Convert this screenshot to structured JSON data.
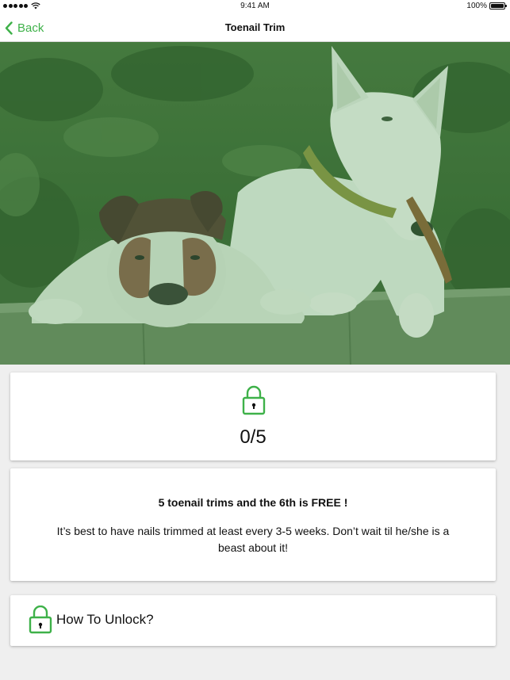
{
  "status_bar": {
    "time": "9:41 AM",
    "battery_text": "100%",
    "battery_level": 1.0,
    "signal_bars": 5,
    "icons": [
      "signal-dots-icon",
      "wifi-icon",
      "battery-icon"
    ]
  },
  "nav": {
    "back_label": "Back",
    "title": "Toenail Trim"
  },
  "colors": {
    "accent": "#3eb149",
    "hero_tint": "#2f7a2f",
    "background": "#efefef",
    "card": "#ffffff"
  },
  "hero": {
    "icon": "dogs-photo"
  },
  "progress": {
    "icon": "lock-icon",
    "count": "0/5",
    "completed": 0,
    "total": 5
  },
  "info": {
    "title": "5 toenail trims and the 6th is FREE !",
    "description": "It’s best to have nails trimmed at least every 3-5 weeks. Don’t wait til he/she is a beast about it!"
  },
  "unlock": {
    "icon": "lock-icon",
    "label": "How To Unlock?"
  }
}
